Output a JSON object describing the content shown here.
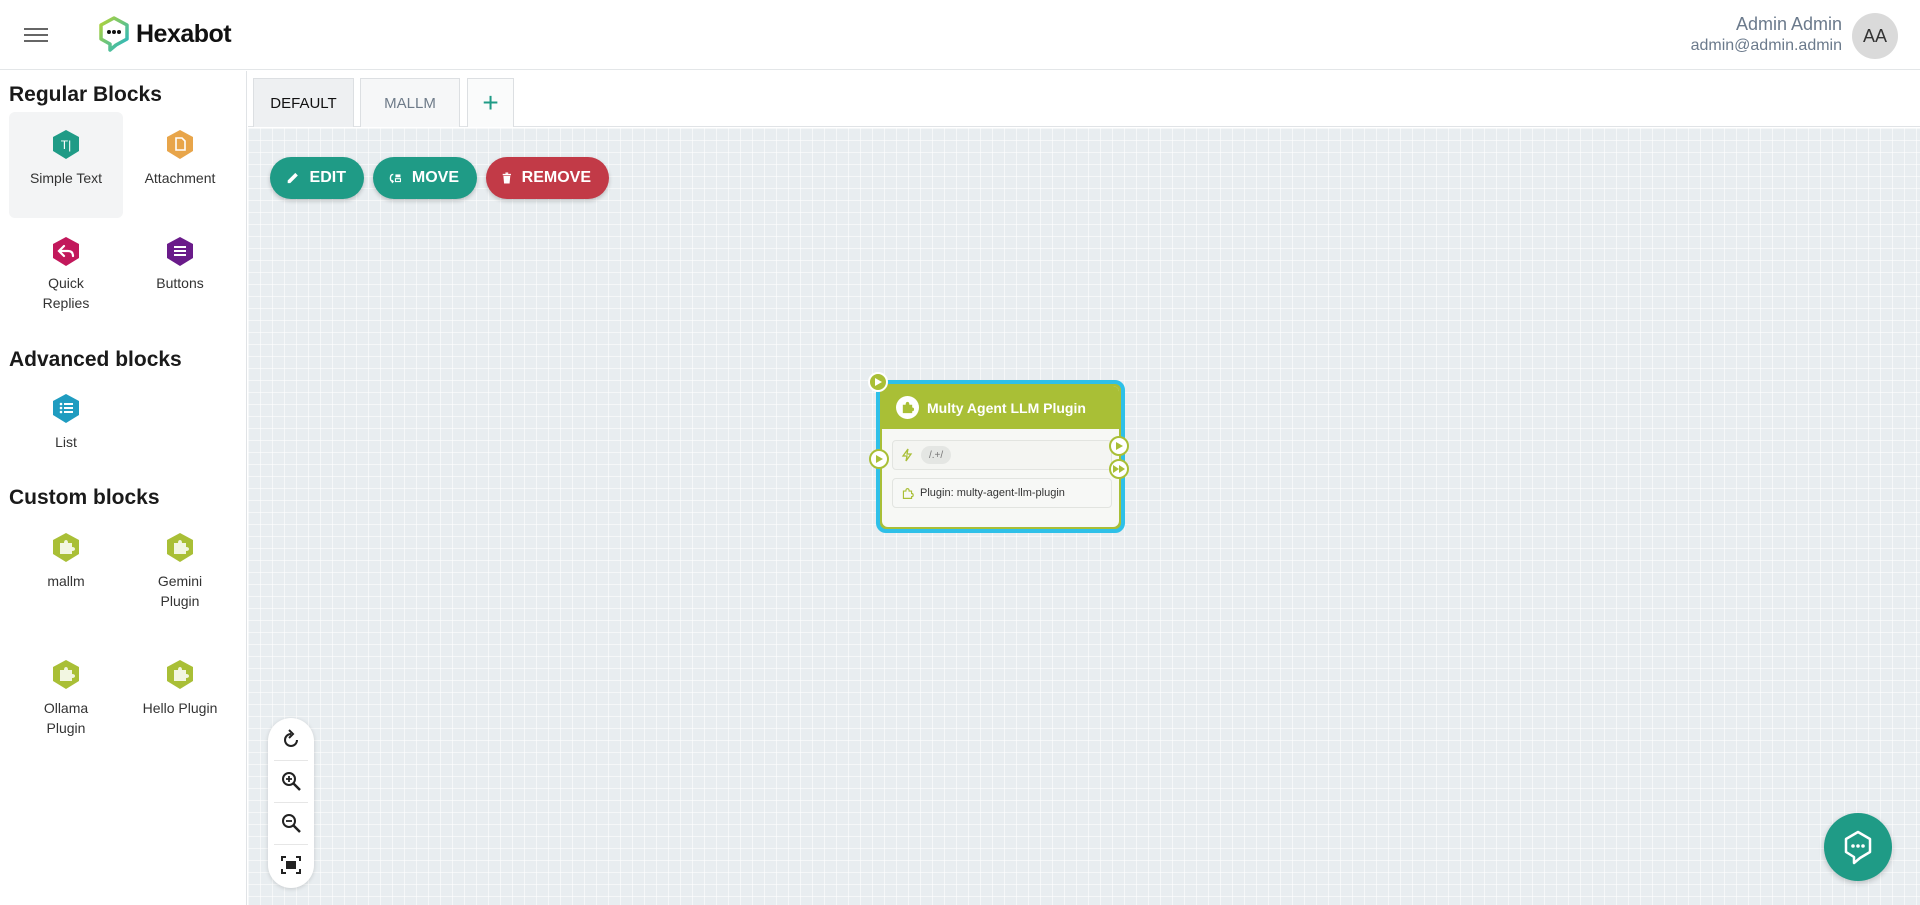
{
  "app": {
    "name": "Hexabot"
  },
  "user": {
    "name": "Admin Admin",
    "email": "admin@admin.admin",
    "initials": "AA"
  },
  "sidebar": {
    "sections": [
      {
        "title": "Regular Blocks",
        "blocks": [
          {
            "label": "Simple Text",
            "icon": "simple-text-icon",
            "color": "#1f9b86",
            "active": true
          },
          {
            "label": "Attachment",
            "icon": "attachment-icon",
            "color": "#e8a54a"
          },
          {
            "label": "Quick Replies",
            "icon": "quick-replies-icon",
            "color": "#c2185b"
          },
          {
            "label": "Buttons",
            "icon": "buttons-icon",
            "color": "#6a1b8a"
          }
        ]
      },
      {
        "title": "Advanced blocks",
        "blocks": [
          {
            "label": "List",
            "icon": "list-icon",
            "color": "#1f9cc0"
          }
        ]
      },
      {
        "title": "Custom blocks",
        "blocks": [
          {
            "label": "mallm",
            "icon": "puzzle-icon",
            "color": "#a9bf36"
          },
          {
            "label": "Gemini Plugin",
            "icon": "puzzle-icon",
            "color": "#a9bf36"
          },
          {
            "label": "Ollama Plugin",
            "icon": "puzzle-icon",
            "color": "#a9bf36"
          },
          {
            "label": "Hello Plugin",
            "icon": "puzzle-icon",
            "color": "#a9bf36"
          }
        ]
      }
    ]
  },
  "tabs": {
    "items": [
      {
        "label": "DEFAULT",
        "active": true
      },
      {
        "label": "MALLM",
        "active": false
      }
    ],
    "add_label": "+"
  },
  "toolbar": {
    "edit_label": "EDIT",
    "move_label": "MOVE",
    "remove_label": "REMOVE"
  },
  "node": {
    "title": "Multy Agent LLM Plugin",
    "pattern": "/.+/",
    "plugin_text": "Plugin: multy-agent-llm-plugin",
    "color": "#a9bf36",
    "selected_border": "#2ec0e8"
  },
  "colors": {
    "primary": "#1f9b86",
    "danger": "#c23a47",
    "canvas": "#e8edf0"
  }
}
